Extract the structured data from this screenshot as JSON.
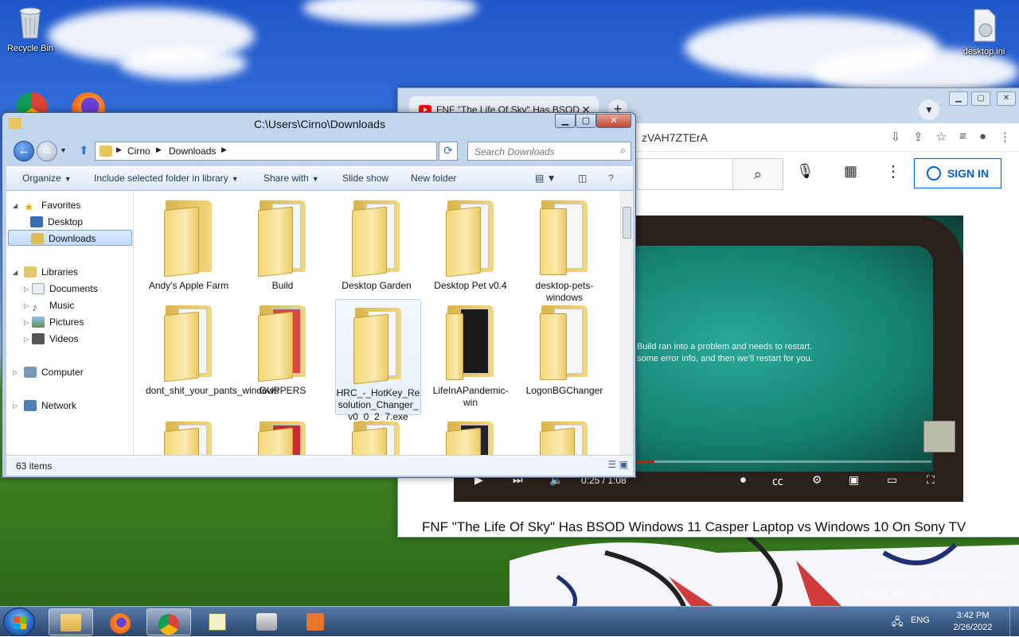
{
  "desktop": {
    "icons": [
      {
        "label": "Recycle Bin",
        "icon": "recycle-bin-icon"
      },
      {
        "label": "desktop.ini",
        "icon": "ini-file-icon"
      }
    ],
    "watermark": {
      "line1": "Windows Developer Preview",
      "line2": "Build 80...eap.110... ...00...K..."
    }
  },
  "browser": {
    "tab_title": "FNF \"The Life Of Sky\" Has BSOD",
    "tab_close": "✕",
    "new_tab": "+",
    "address": "zVAH7ZTErA",
    "sign_in": "SIGN IN",
    "video": {
      "bsod_line1": "Build ran into a problem and needs to restart.",
      "bsod_line2": "some error info, and then we'll restart for you.",
      "time": "0:25 / 1:08",
      "progress": 0.42
    },
    "video_title": "FNF \"The Life Of Sky\" Has BSOD Windows 11 Casper Laptop vs Windows 10 On Sony TV"
  },
  "explorer": {
    "title": "C:\\Users\\Cirno\\Downloads",
    "breadcrumb": [
      "Cirno",
      "Downloads"
    ],
    "search_placeholder": "Search Downloads",
    "commands": {
      "organize": "Organize",
      "include": "Include selected folder in library",
      "share": "Share with",
      "slideshow": "Slide show",
      "new_folder": "New folder"
    },
    "nav": {
      "favorites": "Favorites",
      "desktop": "Desktop",
      "downloads": "Downloads",
      "libraries": "Libraries",
      "documents": "Documents",
      "music": "Music",
      "pictures": "Pictures",
      "videos": "Videos",
      "computer": "Computer",
      "network": "Network"
    },
    "files": [
      {
        "name": "Andy's Apple Farm"
      },
      {
        "name": "Build"
      },
      {
        "name": "Desktop Garden"
      },
      {
        "name": "Desktop Pet v0.4"
      },
      {
        "name": "desktop-pets-windows"
      },
      {
        "name": "dont_shit_your_pants_windows"
      },
      {
        "name": "GUPPERS"
      },
      {
        "name": "HRC_-_HotKey_Resolution_Changer_v0_0_2_7.exe"
      },
      {
        "name": "LifeInAPandemic-win"
      },
      {
        "name": "LogonBGChanger"
      }
    ],
    "status_count": "63 items"
  },
  "taskbar": {
    "language": "ENG",
    "time": "3:42 PM",
    "date": "2/26/2022"
  }
}
